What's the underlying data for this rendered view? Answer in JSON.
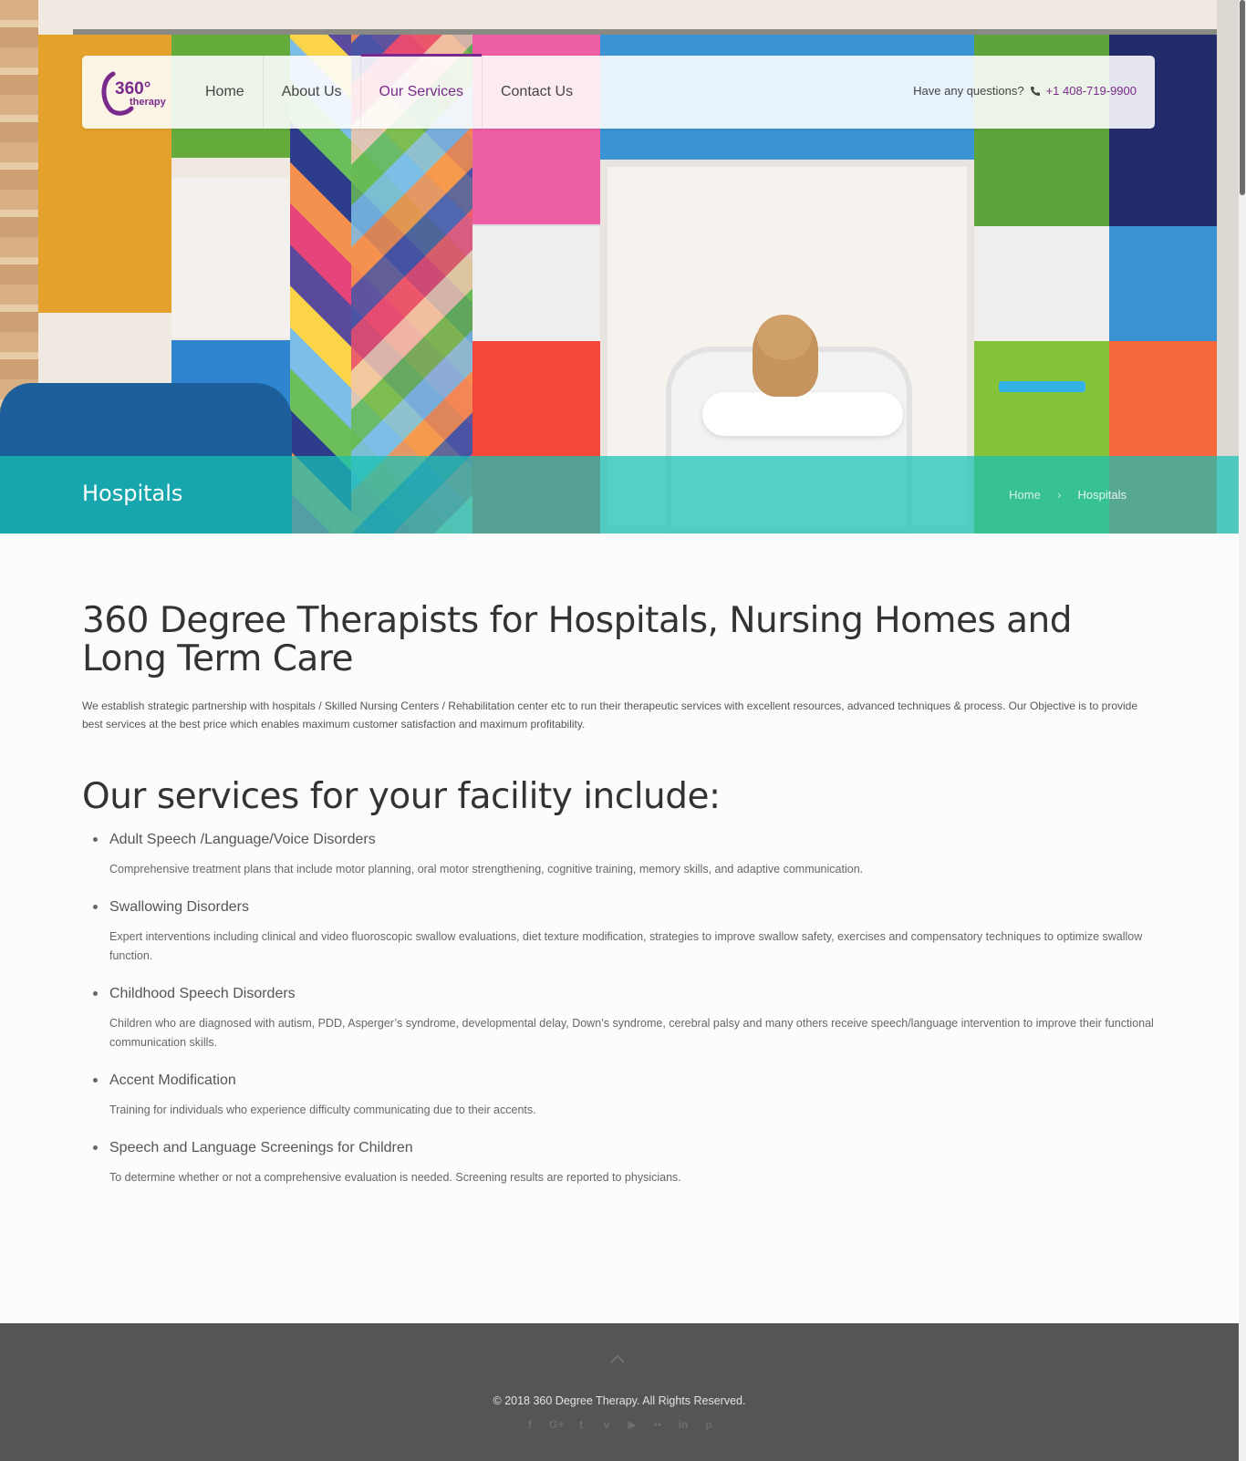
{
  "brand": {
    "logo_number": "360°",
    "logo_word": "therapy",
    "accent_color": "#7a2a8c",
    "teal_color": "#18c2b5"
  },
  "nav": {
    "items": [
      {
        "label": "Home",
        "active": false
      },
      {
        "label": "About Us",
        "active": false
      },
      {
        "label": "Our Services",
        "active": true
      },
      {
        "label": "Contact Us",
        "active": false
      }
    ]
  },
  "contact": {
    "prompt": "Have any questions?",
    "icon": "phone-icon",
    "phone": "+1 408-719-9900"
  },
  "banner": {
    "title": "Hospitals",
    "breadcrumb": {
      "home": "Home",
      "separator": "›",
      "current": "Hospitals"
    }
  },
  "main": {
    "heading": "360 Degree Therapists for Hospitals, Nursing Homes and Long Term Care",
    "intro": "We establish strategic partnership with hospitals / Skilled Nursing Centers / Rehabilitation center etc to run their therapeutic services with excellent resources, advanced techniques & process. Our Objective is to provide best services at the best price which enables maximum customer satisfaction and maximum profitability.",
    "services_heading": "Our services for your facility include:",
    "services": [
      {
        "title": "Adult Speech /Language/Voice Disorders",
        "desc": "Comprehensive treatment plans that include motor planning, oral motor strengthening, cognitive training, memory skills, and adaptive communication."
      },
      {
        "title": "Swallowing Disorders",
        "desc": "Expert interventions including clinical and video fluoroscopic swallow evaluations, diet texture modification, strategies to improve swallow safety, exercises and compensatory techniques to optimize swallow function."
      },
      {
        "title": "Childhood Speech Disorders",
        "desc": "Children who are diagnosed with autism, PDD, Asperger’s syndrome, developmental delay, Down’s syndrome, cerebral palsy and many others receive speech/language intervention to improve their functional communication skills."
      },
      {
        "title": "Accent Modification",
        "desc": "Training for individuals who experience difficulty communicating due to their accents."
      },
      {
        "title": "Speech and Language Screenings for Children",
        "desc": "To determine whether or not a comprehensive evaluation is needed. Screening results are reported to physicians."
      }
    ]
  },
  "footer": {
    "copyright": "© 2018 360 Degree Therapy. All Rights Reserved.",
    "back_to_top_icon": "chevron-up-icon",
    "social": [
      {
        "name": "facebook-icon",
        "glyph": "f"
      },
      {
        "name": "google-plus-icon",
        "glyph": "G+"
      },
      {
        "name": "twitter-icon",
        "glyph": "t"
      },
      {
        "name": "vimeo-icon",
        "glyph": "v"
      },
      {
        "name": "youtube-icon",
        "glyph": "▶"
      },
      {
        "name": "flickr-icon",
        "glyph": "••"
      },
      {
        "name": "linkedin-icon",
        "glyph": "in"
      },
      {
        "name": "pinterest-icon",
        "glyph": "p"
      }
    ]
  }
}
